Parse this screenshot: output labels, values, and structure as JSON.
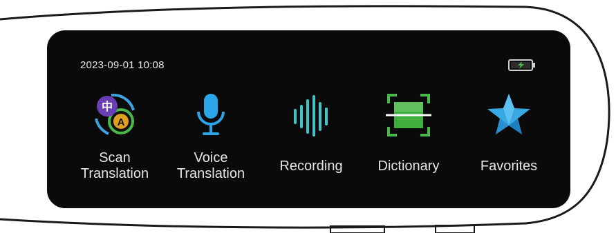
{
  "status_bar": {
    "datetime": "2023-09-01 10:08",
    "battery_icon": "battery-charging-icon"
  },
  "apps": [
    {
      "label_line1": "Scan",
      "label_line2": "Translation",
      "icon": "scan-translation-icon"
    },
    {
      "label_line1": "Voice",
      "label_line2": "Translation",
      "icon": "microphone-icon"
    },
    {
      "label": "Recording",
      "icon": "sound-wave-icon"
    },
    {
      "label": "Dictionary",
      "icon": "scan-frame-icon"
    },
    {
      "label": "Favorites",
      "icon": "star-icon"
    }
  ],
  "badges": {
    "chinese_char": "中",
    "latin_char": "A"
  },
  "colors": {
    "screen_bg": "#0a0a0a",
    "purple": "#6a3fb5",
    "green": "#4ab84a",
    "teal": "#3fc5c8",
    "blue": "#2aa6e8",
    "star": "#39a9e3"
  }
}
